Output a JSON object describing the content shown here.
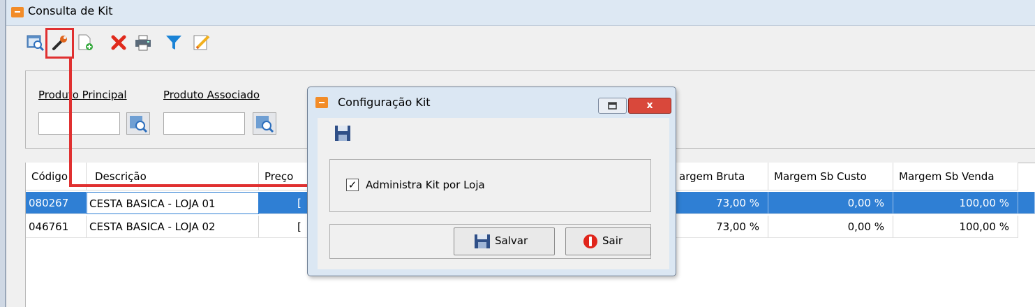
{
  "window": {
    "title": "Consulta de Kit"
  },
  "toolbar": {
    "icons": [
      "view-icon",
      "wrench-icon",
      "new-document-icon",
      "delete-icon",
      "print-icon",
      "filter-icon",
      "edit-icon"
    ]
  },
  "filters": {
    "produto_principal_label": "Produto Principal",
    "produto_associado_label": "Produto Associado",
    "produto_principal_value": "",
    "produto_associado_value": ""
  },
  "grid": {
    "columns": {
      "codigo": "Código",
      "descricao": "Descrição",
      "preco": "Preço",
      "margem_bruta": "Margem Bruta",
      "margem_sb_custo": "Margem Sb Custo",
      "margem_sb_venda": "Margem Sb Venda"
    },
    "header_margem_bruta_visible": "argem Bruta",
    "rows": [
      {
        "codigo": "080267",
        "descricao": "CESTA BASICA - LOJA 01",
        "preco": "[",
        "margem_bruta": "73,00 %",
        "margem_sb_custo": "0,00 %",
        "margem_sb_venda": "100,00 %",
        "selected": true
      },
      {
        "codigo": "046761",
        "descricao": "CESTA BASICA - LOJA 02",
        "preco": "[",
        "margem_bruta": "73,00 %",
        "margem_sb_custo": "0,00 %",
        "margem_sb_venda": "100,00 %",
        "selected": false
      }
    ]
  },
  "dialog": {
    "title": "Configuração Kit",
    "checkbox_label": "Administra Kit por Loja",
    "checkbox_checked": true,
    "checkbox_mark": "✓",
    "close_glyph": "x",
    "save_label": "Salvar",
    "exit_label": "Sair"
  },
  "colors": {
    "selection": "#2f7fd4",
    "highlight": "#e03030",
    "accent": "#f28c28"
  }
}
